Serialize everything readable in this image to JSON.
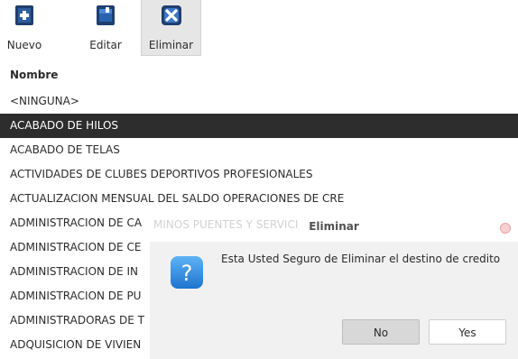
{
  "toolbar": {
    "buttons": [
      {
        "label": "Nuevo",
        "icon": "new-document-icon"
      },
      {
        "label": "Editar",
        "icon": "edit-folder-icon"
      },
      {
        "label": "Eliminar",
        "icon": "delete-icon"
      }
    ]
  },
  "list": {
    "header": "Nombre",
    "selected_index": 1,
    "rows": [
      "<NINGUNA>",
      "ACABADO DE HILOS",
      "ACABADO DE TELAS",
      "ACTIVIDADES DE CLUBES DEPORTIVOS PROFESIONALES",
      "ACTUALIZACION MENSUAL DEL SALDO OPERACIONES DE CRE",
      "ADMINISTRACION DE CA",
      "ADMINISTRACION DE CE",
      "ADMINISTRACION DE IN",
      "ADMINISTRACION DE PU",
      "ADMINISTRADORAS DE T",
      "ADQUISICION DE VIVIEN"
    ],
    "obscured_text": "MINOS PUENTES Y SERVICI"
  },
  "dialog": {
    "title": "Eliminar",
    "message": "Esta Usted Seguro de Eliminar el destino de credito",
    "icon": "question-icon",
    "no_label": "No",
    "yes_label": "Yes"
  },
  "colors": {
    "selected_row": "#2d2d2d",
    "question_icon": "#2a8ee6",
    "close_button": "#f8d0d0"
  }
}
